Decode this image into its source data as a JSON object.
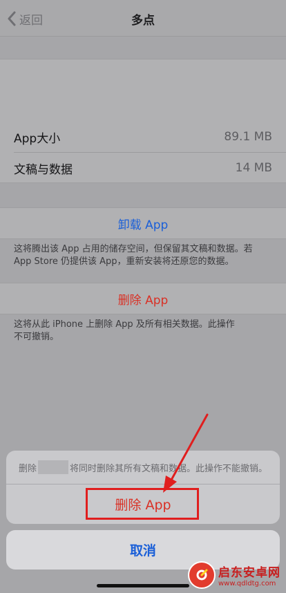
{
  "nav": {
    "back_label": "返回",
    "title": "多点"
  },
  "storage": {
    "rows": [
      {
        "label": "App大小",
        "value": "89.1 MB"
      },
      {
        "label": "文稿与数据",
        "value": "14 MB"
      }
    ]
  },
  "offload": {
    "button_label": "卸载 App",
    "footnote_line1": "这将腾出该 App 占用的储存空间，但保留其文稿和数据。若",
    "footnote_line2": "App Store 仍提供该 App，重新安装将还原您的数据。"
  },
  "delete": {
    "button_label": "删除 App",
    "footnote_line1": "这将从此 iPhone 上删除 App 及所有相关数据。此操作",
    "footnote_line2": "不可撤销。"
  },
  "action_sheet": {
    "message_prefix": "删除",
    "message_suffix": "将同时删除其所有文稿和数据。此操作不能撤销。",
    "delete_label": "删除 App",
    "cancel_label": "取消"
  },
  "watermark": {
    "main": "启东安卓网",
    "sub": "www.qdldtg.com"
  },
  "colors": {
    "blue": "#1a5fd8",
    "red": "#d93025",
    "annotation_red": "#e01e1e"
  },
  "icons": {
    "back": "chevron-left-icon",
    "watermark": "logo-icon"
  }
}
